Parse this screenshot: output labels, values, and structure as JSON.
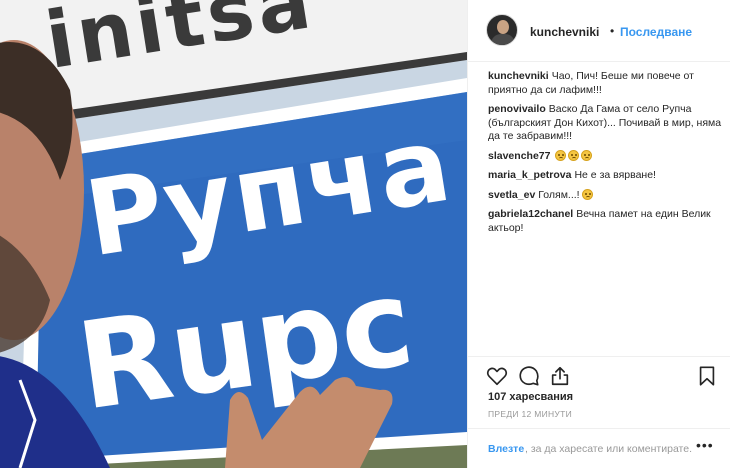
{
  "photo": {
    "sign_top_text": "initsa",
    "sign_cyrillic": "Рупча",
    "sign_latin": "Rupc"
  },
  "header": {
    "username": "kunchevniki",
    "separator": "•",
    "follow_label": "Последване"
  },
  "comments": [
    {
      "user": "kunchevniki",
      "text": "Чао, Пич! Беше ми повече от приятно да си лафим!!!"
    },
    {
      "user": "penovivailo",
      "text": "Васко Да Гама от село Рупча (българският Дон Кихот)... Почивай в мир, няма да те забравим!!!"
    },
    {
      "user": "slavenche77",
      "text": ""
    },
    {
      "user": "maria_k_petrova",
      "text": "Не е за вярване!"
    },
    {
      "user": "svetla_ev",
      "text": "Голям...!"
    },
    {
      "user": "gabriela12chanel",
      "text": "Вечна памет на един Велик актьор!"
    }
  ],
  "actions": {
    "like_icon": "heart-icon",
    "comment_icon": "comment-icon",
    "share_icon": "share-icon",
    "save_icon": "bookmark-icon"
  },
  "likes_text": "107 харесвания",
  "time_ago": "ПРЕДИ 12 МИНУТИ",
  "footer": {
    "login_label": "Влезте",
    "rest_text": ", за да харесате или коментирате.",
    "more_label": "•••"
  }
}
